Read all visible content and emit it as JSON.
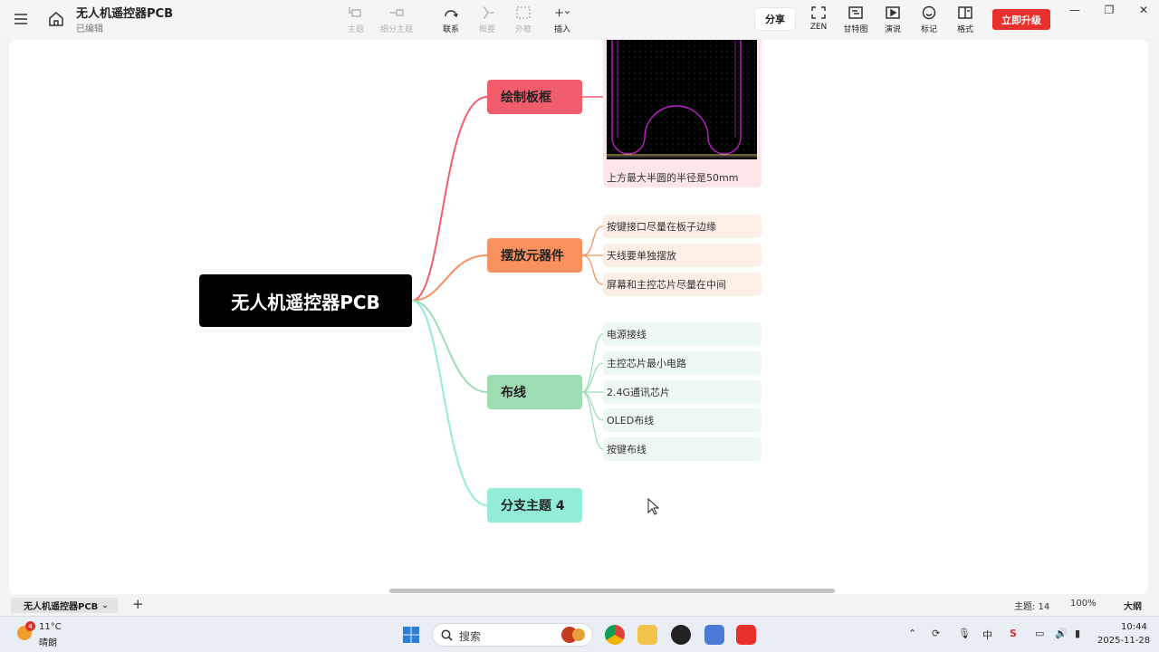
{
  "app": {
    "doc_title": "无人机遥控器PCB",
    "doc_status": "已编辑"
  },
  "toolbar": {
    "topic": "主题",
    "subtopic": "细分主题",
    "relation": "联系",
    "summary": "概要",
    "boundary": "外框",
    "insert": "插入",
    "share": "分享",
    "zen": "ZEN",
    "gantt": "甘特图",
    "present": "演说",
    "marker": "标记",
    "format": "格式",
    "upgrade": "立即升级"
  },
  "mindmap": {
    "root": "无人机遥控器PCB",
    "branches": [
      {
        "label": "绘制板框",
        "color": "#f25d6e",
        "image_caption": "上方最大半圆的半径是50mm",
        "leaves": []
      },
      {
        "label": "摆放元器件",
        "color": "#f8915e",
        "leaves": [
          "按键接口尽量在板子边缘",
          "天线要单独摆放",
          "屏幕和主控芯片尽量在中间"
        ]
      },
      {
        "label": "布线",
        "color": "#9edcb4",
        "leaves": [
          "电源接线",
          "主控芯片最小电路",
          "2.4G通讯芯片",
          "OLED布线",
          "按键布线"
        ]
      },
      {
        "label": "分支主题 4",
        "color": "#92ecd8",
        "leaves": []
      }
    ]
  },
  "status": {
    "sheet": "无人机遥控器PCB",
    "topic_count": "主题: 14",
    "zoom": "100%",
    "outline": "大纲"
  },
  "taskbar": {
    "weather_badge": "4",
    "temperature": "11°C",
    "weather": "晴朗",
    "search": "搜索",
    "time": "10:44",
    "date": "2025-11-28",
    "ime": "中",
    "ime2": "S"
  }
}
